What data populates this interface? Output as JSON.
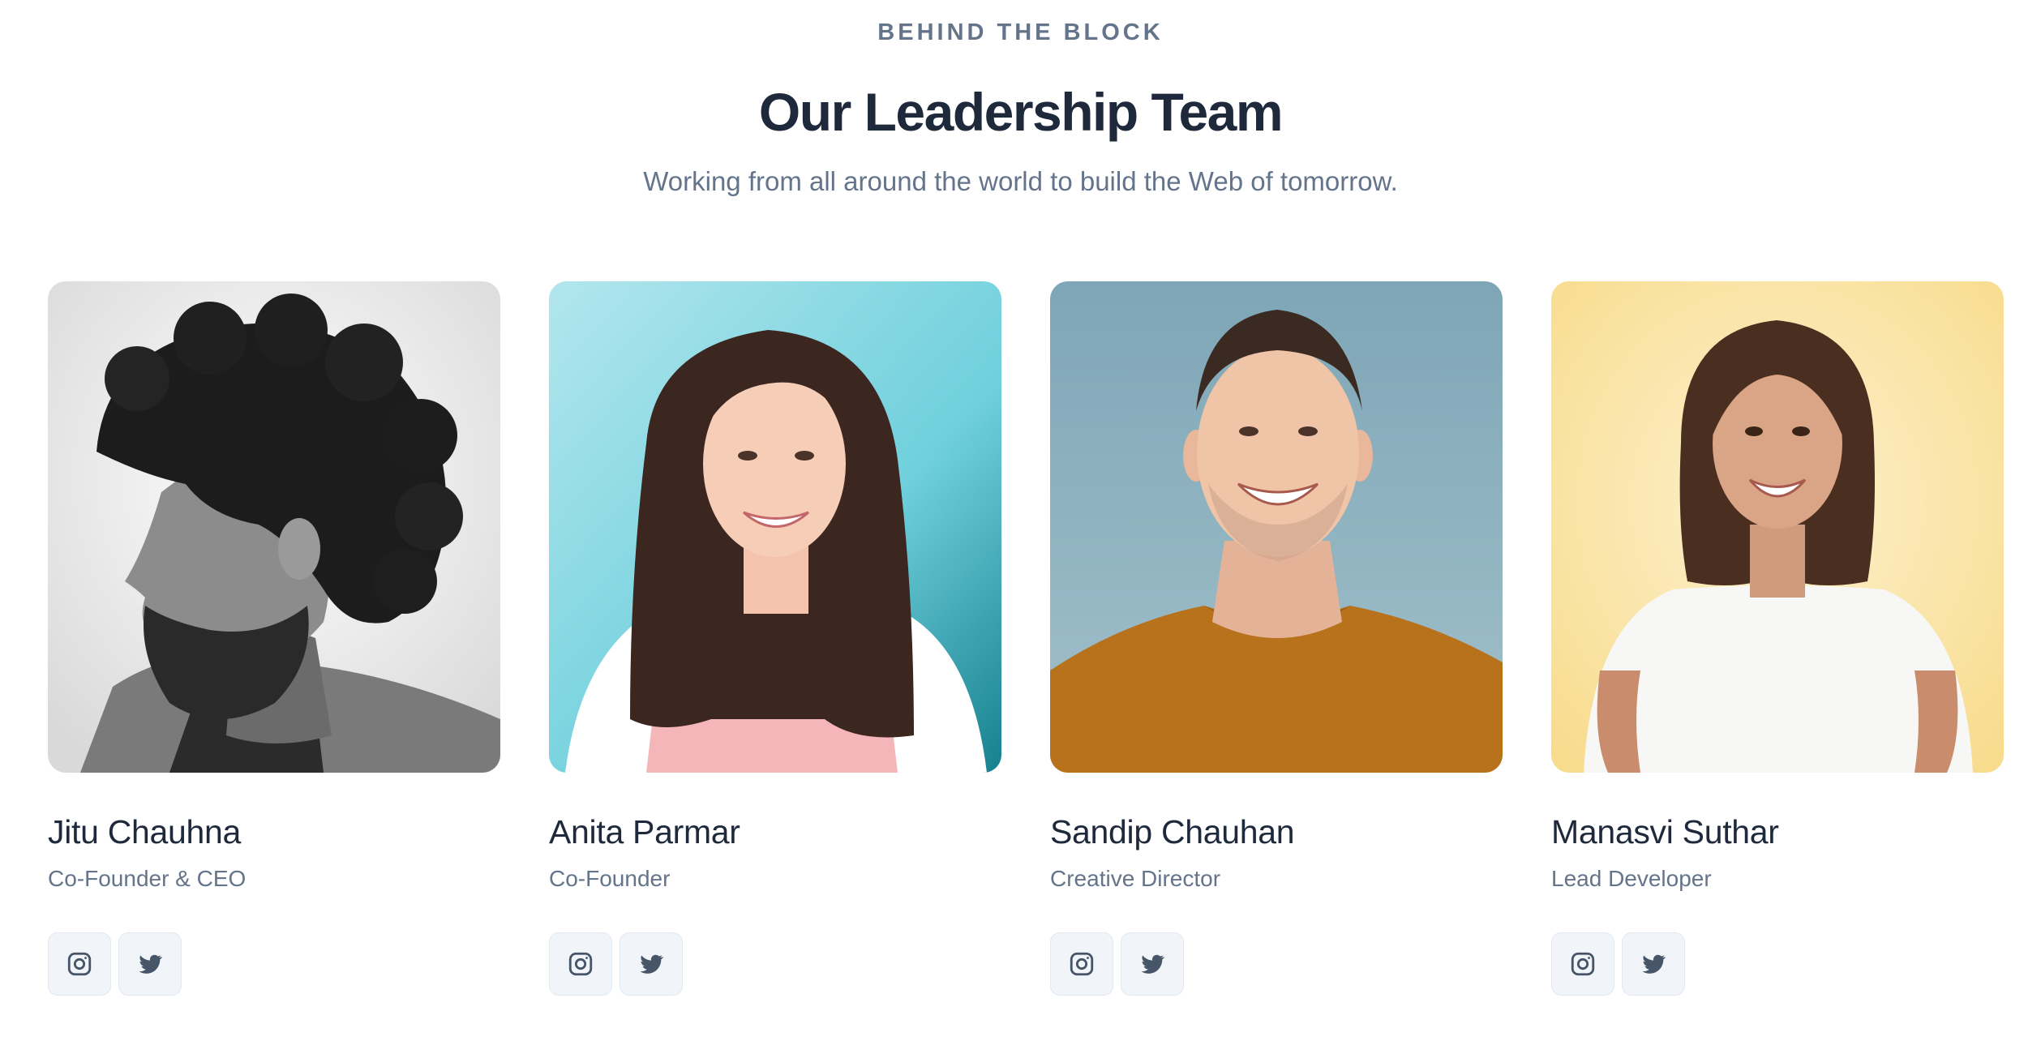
{
  "header": {
    "eyebrow": "BEHIND THE BLOCK",
    "title": "Our Leadership Team",
    "subtitle": "Working from all around the world to build the Web of tomorrow."
  },
  "colors": {
    "heading": "#1e293b",
    "muted": "#64748b",
    "button_bg": "#f1f5f9",
    "icon": "#475569"
  },
  "team": [
    {
      "name": "Jitu Chauhna",
      "role": "Co-Founder & CEO",
      "photo_bg": "#efefef",
      "icons": [
        "instagram-icon",
        "twitter-icon"
      ]
    },
    {
      "name": "Anita Parmar",
      "role": "Co-Founder",
      "photo_bg": "#8fd9e3",
      "icons": [
        "instagram-icon",
        "twitter-icon"
      ]
    },
    {
      "name": "Sandip Chauhan",
      "role": "Creative Director",
      "photo_bg": "#8fafbc",
      "icons": [
        "instagram-icon",
        "twitter-icon"
      ]
    },
    {
      "name": "Manasvi Suthar",
      "role": "Lead Developer",
      "photo_bg": "#fbe7b0",
      "icons": [
        "instagram-icon",
        "twitter-icon"
      ]
    }
  ]
}
